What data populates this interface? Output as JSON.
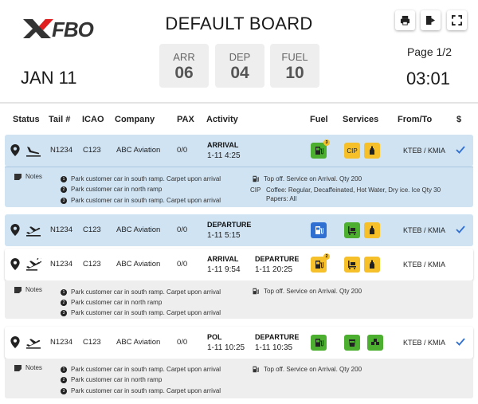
{
  "header": {
    "logo_text": "XJFBO",
    "title": "DEFAULT BOARD",
    "date": "JAN 11",
    "stats": [
      {
        "label": "ARR",
        "value": "06"
      },
      {
        "label": "DEP",
        "value": "04"
      },
      {
        "label": "FUEL",
        "value": "10"
      }
    ],
    "page": "Page 1/2",
    "clock": "03:01",
    "buttons": [
      "print-icon",
      "exit-icon",
      "fullscreen-icon"
    ]
  },
  "columns": [
    "Status",
    "Tail #",
    "ICAO",
    "Company",
    "PAX",
    "Activity",
    "Fuel",
    "Services",
    "From/To",
    "$"
  ],
  "rows": [
    {
      "tail": "N1234",
      "icao": "C123",
      "company": "ABC Aviation",
      "pax": "0/0",
      "activity": [
        {
          "type": "ARRIVAL",
          "time": "1-11 4:25"
        }
      ],
      "fuel_badge": "3",
      "services": [
        "CIP",
        "bottle-icon"
      ],
      "route": "KTEB / KMIA",
      "paid": true,
      "notes_label": "Notes",
      "notes": [
        "Park customer car in south ramp. Carpet upon arrival",
        "Park customer car in north ramp",
        "Park customer car in south ramp. Carpet upon arrival"
      ],
      "service_notes": [
        {
          "tag": "",
          "text": "Top off. Service on Arrival. Qty 200"
        },
        {
          "tag": "CIP",
          "text": "Coffee: Regular, Decaffeinated, Hot Water, Dry ice. Ice Qty 30"
        },
        {
          "tag": "",
          "text": "Papers: All"
        }
      ]
    },
    {
      "tail": "N1234",
      "icao": "C123",
      "company": "ABC Aviation",
      "pax": "0/0",
      "activity": [
        {
          "type": "DEPARTURE",
          "time": "1-11 5:15"
        }
      ],
      "route": "KTEB / KMIA",
      "paid": true
    },
    {
      "tail": "N1234",
      "icao": "C123",
      "company": "ABC Aviation",
      "pax": "0/0",
      "activity": [
        {
          "type": "ARRIVAL",
          "time": "1-11 9:54"
        },
        {
          "type": "DEPARTURE",
          "time": "1-11 20:25"
        }
      ],
      "fuel_badge": "2",
      "route": "KTEB / KMIA",
      "paid": false,
      "notes_label": "Notes",
      "notes": [
        "Park customer car in south ramp. Carpet upon arrival",
        "Park customer car in north ramp",
        "Park customer car in south ramp. Carpet upon arrival"
      ],
      "service_notes": [
        {
          "tag": "",
          "text": "Top off. Service on Arrival. Qty 200"
        }
      ]
    },
    {
      "tail": "N1234",
      "icao": "C123",
      "company": "ABC Aviation",
      "pax": "0/0",
      "activity": [
        {
          "type": "POL",
          "time": "1-11 10:25"
        },
        {
          "type": "DEPARTURE",
          "time": "1-11 10:35"
        }
      ],
      "route": "KTEB / KMIA",
      "paid": true,
      "notes_label": "Notes",
      "notes": [
        "Park customer car in south ramp. Carpet upon arrival",
        "Park customer car in north ramp",
        "Park customer car in south ramp. Carpet upon arrival"
      ],
      "service_notes": [
        {
          "tag": "",
          "text": "Top off. Service on Arrival. Qty 200"
        }
      ]
    }
  ],
  "colors": {
    "green": "#4caf2f",
    "yellow": "#f6c02a",
    "blue": "#2f6fd1",
    "row_blue": "#cfe3f3",
    "check": "#2f6fd1"
  }
}
